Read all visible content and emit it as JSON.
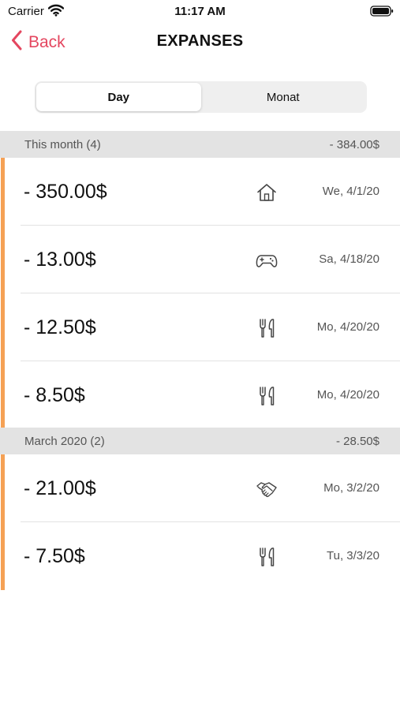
{
  "status_bar": {
    "carrier": "Carrier",
    "time": "11:17 AM"
  },
  "nav": {
    "back_label": "Back",
    "title": "EXPANSES"
  },
  "segments": [
    {
      "label": "Day",
      "selected": true
    },
    {
      "label": "Monat",
      "selected": false
    }
  ],
  "colors": {
    "accent": "#e4465f",
    "timeline": "#f5a155"
  },
  "sections": [
    {
      "title": "This month (4)",
      "total": "- 384.00$",
      "items": [
        {
          "amount": "- 350.00$",
          "icon": "home-icon",
          "date": "We, 4/1/20"
        },
        {
          "amount": "- 13.00$",
          "icon": "gamepad-icon",
          "date": "Sa, 4/18/20"
        },
        {
          "amount": "- 12.50$",
          "icon": "cutlery-icon",
          "date": "Mo, 4/20/20"
        },
        {
          "amount": "- 8.50$",
          "icon": "cutlery-icon",
          "date": "Mo, 4/20/20"
        }
      ]
    },
    {
      "title": "March 2020 (2)",
      "total": "- 28.50$",
      "items": [
        {
          "amount": "- 21.00$",
          "icon": "handshake-icon",
          "date": "Mo, 3/2/20"
        },
        {
          "amount": "- 7.50$",
          "icon": "cutlery-icon",
          "date": "Tu, 3/3/20"
        }
      ]
    }
  ]
}
